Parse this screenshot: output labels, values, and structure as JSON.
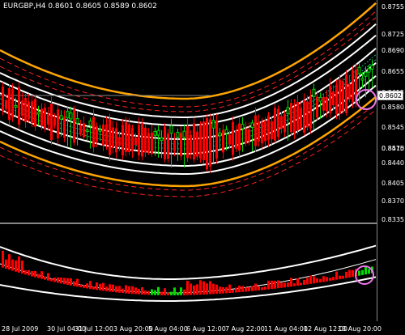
{
  "header": {
    "symbol": "EURGBP,H4",
    "ohlc": "0.8601 0.8605 0.8589 0.8602"
  },
  "price_axis": {
    "ticks": [
      "0.8755",
      "0.8725",
      "0.8690",
      "0.8655",
      "0.8615",
      "0.8580",
      "0.8545",
      "0.8510",
      "0.8475",
      "0.8440",
      "0.8405",
      "0.8370",
      "0.8335"
    ],
    "current_price": "0.8602"
  },
  "date_axis": {
    "ticks": [
      "28 Jul 2009",
      "30 Jul 04:00",
      "31 Jul 12:00",
      "3 Aug 20:00",
      "5 Aug 04:00",
      "6 Aug 12:00",
      "7 Aug 22:00",
      "11 Aug 04:00",
      "12 Aug 12:00",
      "13 Aug 20:00"
    ]
  },
  "colors": {
    "bear": "#ff0000",
    "bull": "#00dd00",
    "band_outer": "#ffa500",
    "band_inner": "#ffffff",
    "dashed_red": "#ff2222",
    "highlight_circle": "#ee77ee"
  }
}
